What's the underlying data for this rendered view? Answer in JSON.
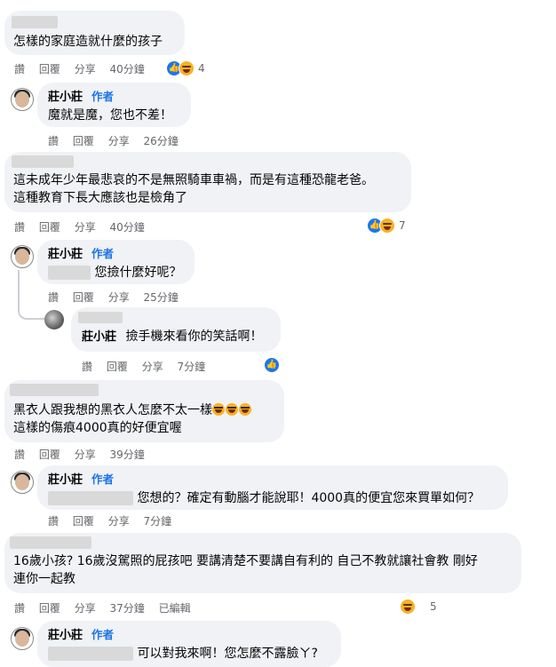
{
  "actions": {
    "like": "讚",
    "reply": "回覆",
    "share": "分享",
    "edited": "已編輯"
  },
  "author_badge": "作者",
  "comments": [
    {
      "text": "怎樣的家庭造就什麼的孩子",
      "time": "40分鐘",
      "reactions": "4"
    },
    {
      "name": "莊小莊",
      "text": "魔就是魔，您也不差！",
      "time": "26分鐘"
    },
    {
      "line1": "這未成年少年最悲哀的不是無照騎車車禍，而是有這種恐龍老爸。",
      "line2": "這種教育下長大應該也是檢角了",
      "time": "40分鐘",
      "reactions": "7"
    },
    {
      "name": "莊小莊",
      "text": "您撿什麼好呢？",
      "time": "25分鐘"
    },
    {
      "name": "莊小莊",
      "text": "撿手機來看你的笑話啊！",
      "time": "7分鐘"
    },
    {
      "line1": "黑衣人跟我想的黑衣人怎麼不太一樣",
      "line2": "這樣的傷痕4000真的好便宜喔",
      "time": "39分鐘"
    },
    {
      "name": "莊小莊",
      "text": "您想的？確定有動腦才能說耶！4000真的便宜您來買單如何？",
      "time": "7分鐘"
    },
    {
      "line1": "16歲小孩? 16歲沒駕照的屁孩吧 要講清楚不要講自有利的 自己不教就讓社會教 剛好",
      "line2": "連你一起教",
      "time": "37分鐘",
      "reactions": "5"
    },
    {
      "name": "莊小莊",
      "text": "可以對我來啊！您怎麼不露臉ㄚ?"
    }
  ]
}
